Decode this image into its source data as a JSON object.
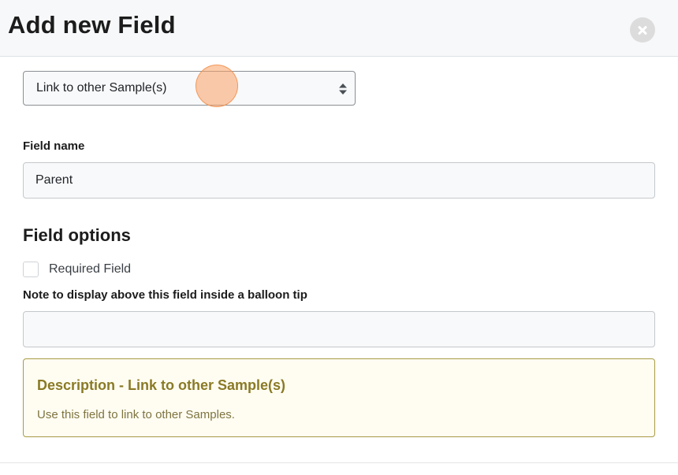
{
  "header": {
    "title": "Add new Field"
  },
  "field_type": {
    "selected": "Link to other Sample(s)"
  },
  "field_name": {
    "label": "Field name",
    "value": "Parent"
  },
  "options": {
    "title": "Field options",
    "required_label": "Required Field",
    "required_checked": false,
    "note_label": "Note to display above this field inside a balloon tip",
    "note_value": ""
  },
  "description": {
    "title": "Description - Link to other Sample(s)",
    "text": "Use this field to link to other Samples."
  },
  "colors": {
    "header_bg": "#f7f8f9",
    "description_border": "#a89a45",
    "description_title": "#8a7a25",
    "description_bg": "#fffdf2",
    "cursor_highlight": "#faa064"
  },
  "icons": {
    "close": "close-icon",
    "select_arrows": "sort-arrows-icon"
  }
}
